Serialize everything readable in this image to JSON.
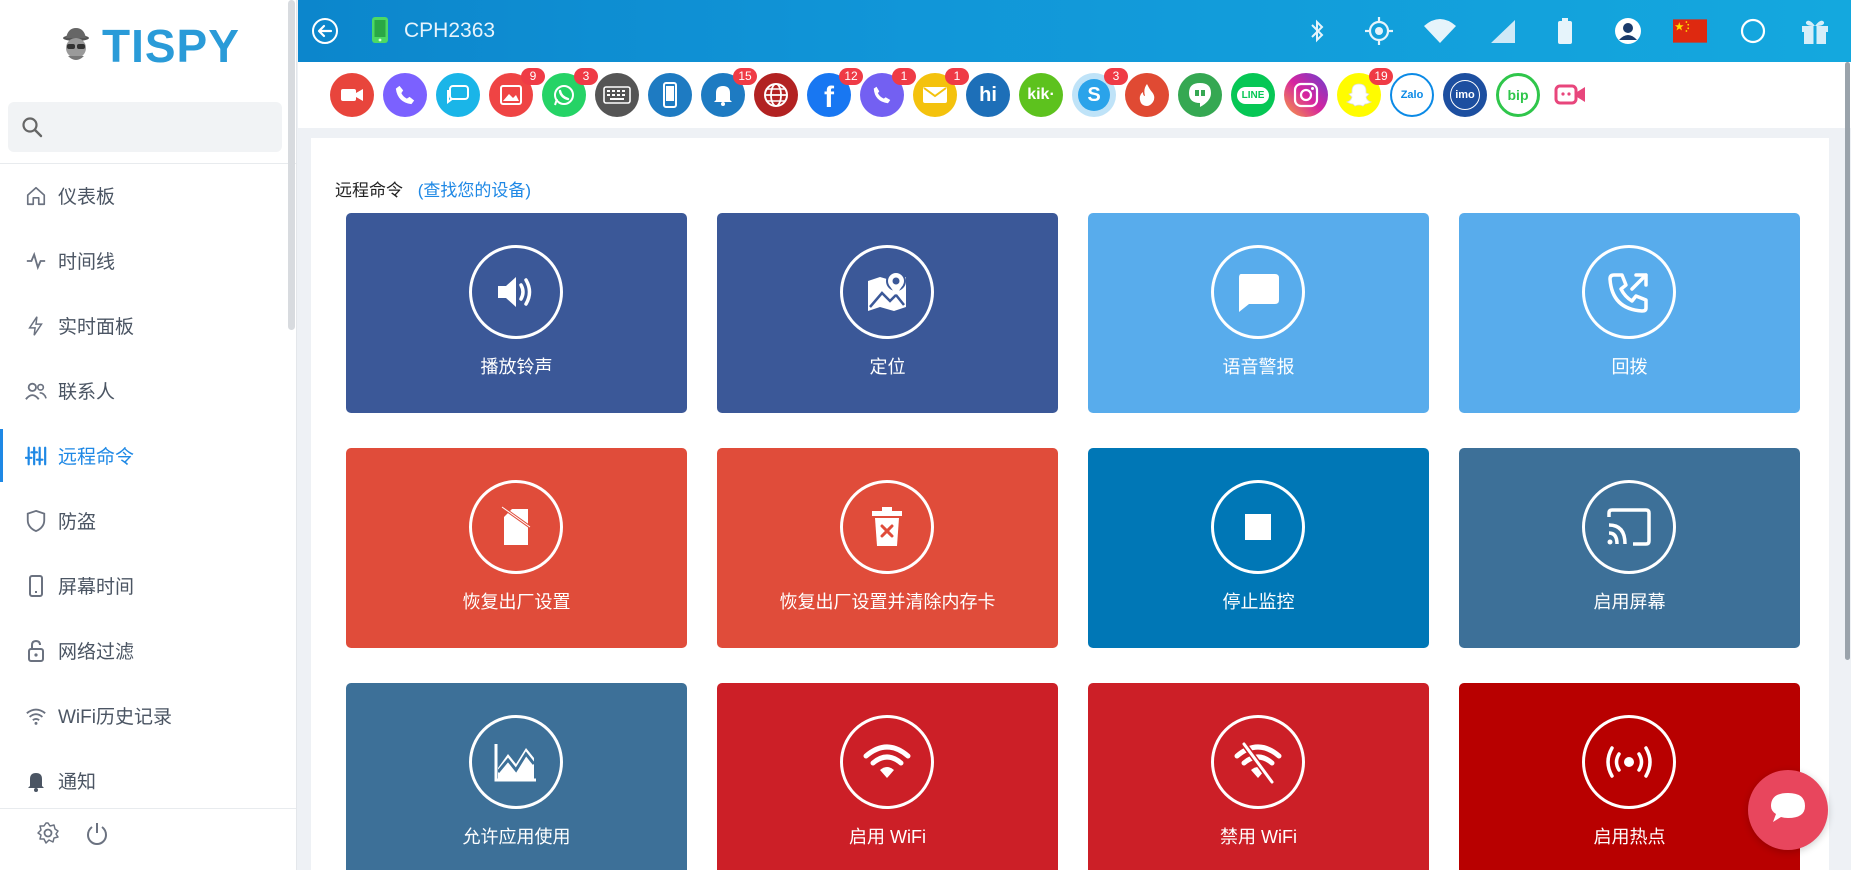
{
  "logo": {
    "text": "TISPY"
  },
  "search": {
    "placeholder": ""
  },
  "nav": [
    {
      "label": "仪表板",
      "icon": "home-icon"
    },
    {
      "label": "时间线",
      "icon": "activity-icon"
    },
    {
      "label": "实时面板",
      "icon": "bolt-icon"
    },
    {
      "label": "联系人",
      "icon": "contacts-icon"
    },
    {
      "label": "远程命令",
      "icon": "sliders-icon",
      "active": true
    },
    {
      "label": "防盗",
      "icon": "shield-icon"
    },
    {
      "label": "屏幕时间",
      "icon": "phone-icon"
    },
    {
      "label": "网络过滤",
      "icon": "lock-icon"
    },
    {
      "label": "WiFi历史记录",
      "icon": "wifi-icon"
    },
    {
      "label": "通知",
      "icon": "bell-icon"
    }
  ],
  "topbar": {
    "device_name": "CPH2363"
  },
  "apps": [
    {
      "name": "video-call",
      "color": "#e8453c",
      "badge": ""
    },
    {
      "name": "phone",
      "color": "#7b61ff",
      "badge": ""
    },
    {
      "name": "messages",
      "color": "#1ab5e8",
      "badge": ""
    },
    {
      "name": "gallery",
      "color": "#ef4444",
      "badge": "9"
    },
    {
      "name": "whatsapp",
      "color": "#25d366",
      "badge": "3"
    },
    {
      "name": "keyboard",
      "color": "#555555",
      "badge": ""
    },
    {
      "name": "device",
      "color": "#1e7bc2",
      "badge": ""
    },
    {
      "name": "notifications",
      "color": "#1e7bc2",
      "badge": "15"
    },
    {
      "name": "browser",
      "color": "#b22222",
      "badge": ""
    },
    {
      "name": "facebook",
      "color": "#1877f2",
      "badge": "12"
    },
    {
      "name": "viber",
      "color": "#7360f2",
      "badge": "1"
    },
    {
      "name": "email",
      "color": "#f4c20d",
      "badge": "1"
    },
    {
      "name": "hike",
      "color": "#1d6fb8",
      "badge": "",
      "text": "hi"
    },
    {
      "name": "kik",
      "color": "#5dc21e",
      "badge": "",
      "text": "kik·"
    },
    {
      "name": "skype",
      "color": "#7fc8f0",
      "badge": "3",
      "text": "S"
    },
    {
      "name": "tinder",
      "color": "#e04a33",
      "badge": ""
    },
    {
      "name": "hangouts",
      "color": "#35a852",
      "badge": ""
    },
    {
      "name": "line",
      "color": "#06c755",
      "badge": "",
      "text": "LINE"
    },
    {
      "name": "instagram",
      "color": "#d6249f",
      "badge": ""
    },
    {
      "name": "snapchat",
      "color": "#fffc00",
      "badge": "19"
    },
    {
      "name": "zalo",
      "color": "#ffffff",
      "badge": "",
      "text": "Zalo"
    },
    {
      "name": "imo",
      "color": "#1d4fa0",
      "badge": "",
      "text": "imo"
    },
    {
      "name": "bip",
      "color": "#ffffff",
      "badge": "",
      "text": "bip"
    },
    {
      "name": "video-chat",
      "color": "#ffffff",
      "badge": ""
    }
  ],
  "panel": {
    "title": "远程命令",
    "link": "(查找您的设备)"
  },
  "commands": [
    {
      "label": "播放铃声",
      "icon": "speaker-icon",
      "color": "#3b5898"
    },
    {
      "label": "定位",
      "icon": "map-pin-icon",
      "color": "#3b5898"
    },
    {
      "label": "语音警报",
      "icon": "chat-bubble-icon",
      "color": "#58acec"
    },
    {
      "label": "回拨",
      "icon": "phone-callback-icon",
      "color": "#58acec"
    },
    {
      "label": "恢复出厂设置",
      "icon": "eraser-icon",
      "color": "#e04c3a"
    },
    {
      "label": "恢复出厂设置并清除内存卡",
      "icon": "trash-icon",
      "color": "#e04c3a"
    },
    {
      "label": "停止监控",
      "icon": "stop-icon",
      "color": "#0077b6"
    },
    {
      "label": "启用屏幕",
      "icon": "cast-icon",
      "color": "#3d7098"
    },
    {
      "label": "允许应用使用",
      "icon": "chart-icon",
      "color": "#3d7098"
    },
    {
      "label": "启用 WiFi",
      "icon": "wifi-on-icon",
      "color": "#cc1f27"
    },
    {
      "label": "禁用 WiFi",
      "icon": "wifi-off-icon",
      "color": "#cc1f27"
    },
    {
      "label": "启用热点",
      "icon": "hotspot-icon",
      "color": "#b80000"
    }
  ]
}
